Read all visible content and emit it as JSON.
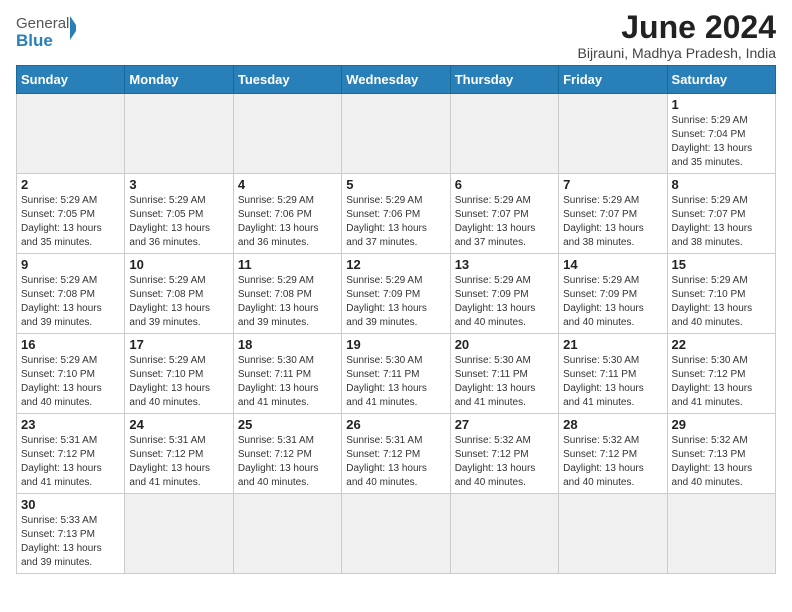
{
  "logo": {
    "general": "General",
    "blue": "Blue"
  },
  "title": "June 2024",
  "location": "Bijrauni, Madhya Pradesh, India",
  "weekdays": [
    "Sunday",
    "Monday",
    "Tuesday",
    "Wednesday",
    "Thursday",
    "Friday",
    "Saturday"
  ],
  "days": [
    {
      "day": "",
      "info": ""
    },
    {
      "day": "",
      "info": ""
    },
    {
      "day": "",
      "info": ""
    },
    {
      "day": "",
      "info": ""
    },
    {
      "day": "",
      "info": ""
    },
    {
      "day": "",
      "info": ""
    },
    {
      "day": "1",
      "info": "Sunrise: 5:29 AM\nSunset: 7:04 PM\nDaylight: 13 hours and 35 minutes."
    },
    {
      "day": "2",
      "info": "Sunrise: 5:29 AM\nSunset: 7:05 PM\nDaylight: 13 hours and 35 minutes."
    },
    {
      "day": "3",
      "info": "Sunrise: 5:29 AM\nSunset: 7:05 PM\nDaylight: 13 hours and 36 minutes."
    },
    {
      "day": "4",
      "info": "Sunrise: 5:29 AM\nSunset: 7:06 PM\nDaylight: 13 hours and 36 minutes."
    },
    {
      "day": "5",
      "info": "Sunrise: 5:29 AM\nSunset: 7:06 PM\nDaylight: 13 hours and 37 minutes."
    },
    {
      "day": "6",
      "info": "Sunrise: 5:29 AM\nSunset: 7:07 PM\nDaylight: 13 hours and 37 minutes."
    },
    {
      "day": "7",
      "info": "Sunrise: 5:29 AM\nSunset: 7:07 PM\nDaylight: 13 hours and 38 minutes."
    },
    {
      "day": "8",
      "info": "Sunrise: 5:29 AM\nSunset: 7:07 PM\nDaylight: 13 hours and 38 minutes."
    },
    {
      "day": "9",
      "info": "Sunrise: 5:29 AM\nSunset: 7:08 PM\nDaylight: 13 hours and 39 minutes."
    },
    {
      "day": "10",
      "info": "Sunrise: 5:29 AM\nSunset: 7:08 PM\nDaylight: 13 hours and 39 minutes."
    },
    {
      "day": "11",
      "info": "Sunrise: 5:29 AM\nSunset: 7:08 PM\nDaylight: 13 hours and 39 minutes."
    },
    {
      "day": "12",
      "info": "Sunrise: 5:29 AM\nSunset: 7:09 PM\nDaylight: 13 hours and 39 minutes."
    },
    {
      "day": "13",
      "info": "Sunrise: 5:29 AM\nSunset: 7:09 PM\nDaylight: 13 hours and 40 minutes."
    },
    {
      "day": "14",
      "info": "Sunrise: 5:29 AM\nSunset: 7:09 PM\nDaylight: 13 hours and 40 minutes."
    },
    {
      "day": "15",
      "info": "Sunrise: 5:29 AM\nSunset: 7:10 PM\nDaylight: 13 hours and 40 minutes."
    },
    {
      "day": "16",
      "info": "Sunrise: 5:29 AM\nSunset: 7:10 PM\nDaylight: 13 hours and 40 minutes."
    },
    {
      "day": "17",
      "info": "Sunrise: 5:29 AM\nSunset: 7:10 PM\nDaylight: 13 hours and 40 minutes."
    },
    {
      "day": "18",
      "info": "Sunrise: 5:30 AM\nSunset: 7:11 PM\nDaylight: 13 hours and 41 minutes."
    },
    {
      "day": "19",
      "info": "Sunrise: 5:30 AM\nSunset: 7:11 PM\nDaylight: 13 hours and 41 minutes."
    },
    {
      "day": "20",
      "info": "Sunrise: 5:30 AM\nSunset: 7:11 PM\nDaylight: 13 hours and 41 minutes."
    },
    {
      "day": "21",
      "info": "Sunrise: 5:30 AM\nSunset: 7:11 PM\nDaylight: 13 hours and 41 minutes."
    },
    {
      "day": "22",
      "info": "Sunrise: 5:30 AM\nSunset: 7:12 PM\nDaylight: 13 hours and 41 minutes."
    },
    {
      "day": "23",
      "info": "Sunrise: 5:31 AM\nSunset: 7:12 PM\nDaylight: 13 hours and 41 minutes."
    },
    {
      "day": "24",
      "info": "Sunrise: 5:31 AM\nSunset: 7:12 PM\nDaylight: 13 hours and 41 minutes."
    },
    {
      "day": "25",
      "info": "Sunrise: 5:31 AM\nSunset: 7:12 PM\nDaylight: 13 hours and 40 minutes."
    },
    {
      "day": "26",
      "info": "Sunrise: 5:31 AM\nSunset: 7:12 PM\nDaylight: 13 hours and 40 minutes."
    },
    {
      "day": "27",
      "info": "Sunrise: 5:32 AM\nSunset: 7:12 PM\nDaylight: 13 hours and 40 minutes."
    },
    {
      "day": "28",
      "info": "Sunrise: 5:32 AM\nSunset: 7:12 PM\nDaylight: 13 hours and 40 minutes."
    },
    {
      "day": "29",
      "info": "Sunrise: 5:32 AM\nSunset: 7:13 PM\nDaylight: 13 hours and 40 minutes."
    },
    {
      "day": "30",
      "info": "Sunrise: 5:33 AM\nSunset: 7:13 PM\nDaylight: 13 hours and 39 minutes."
    }
  ]
}
